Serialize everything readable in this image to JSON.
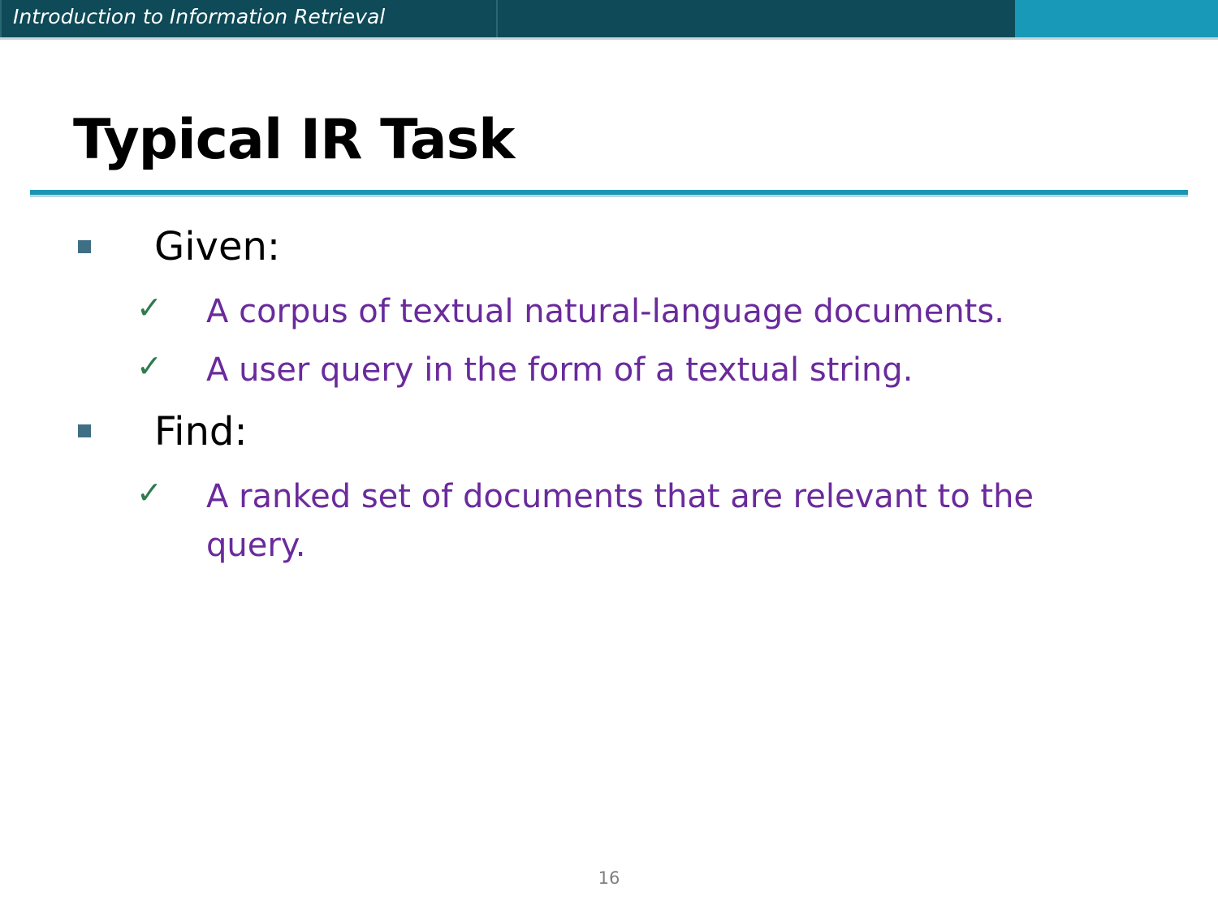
{
  "header": {
    "title": "Introduction to Information Retrieval"
  },
  "slide": {
    "title": "Typical IR Task",
    "sections": [
      {
        "label": "Given:",
        "items": [
          "A corpus of textual natural-language documents.",
          "A user query in the form of a textual string."
        ]
      },
      {
        "label": "Find:",
        "items": [
          "A ranked set of documents that are relevant to the query."
        ]
      }
    ]
  },
  "page_number": "16",
  "icons": {
    "level1_bullet": "square-bullet-icon",
    "level2_bullet": "checkmark-icon"
  },
  "colors": {
    "header_dark": "#0e4a57",
    "header_accent": "#1899b8",
    "title_rule": "#1c95b3",
    "bullet_square": "#3f6f85",
    "checkmark": "#2f7a4e",
    "sub_text": "#6a2a9c"
  }
}
